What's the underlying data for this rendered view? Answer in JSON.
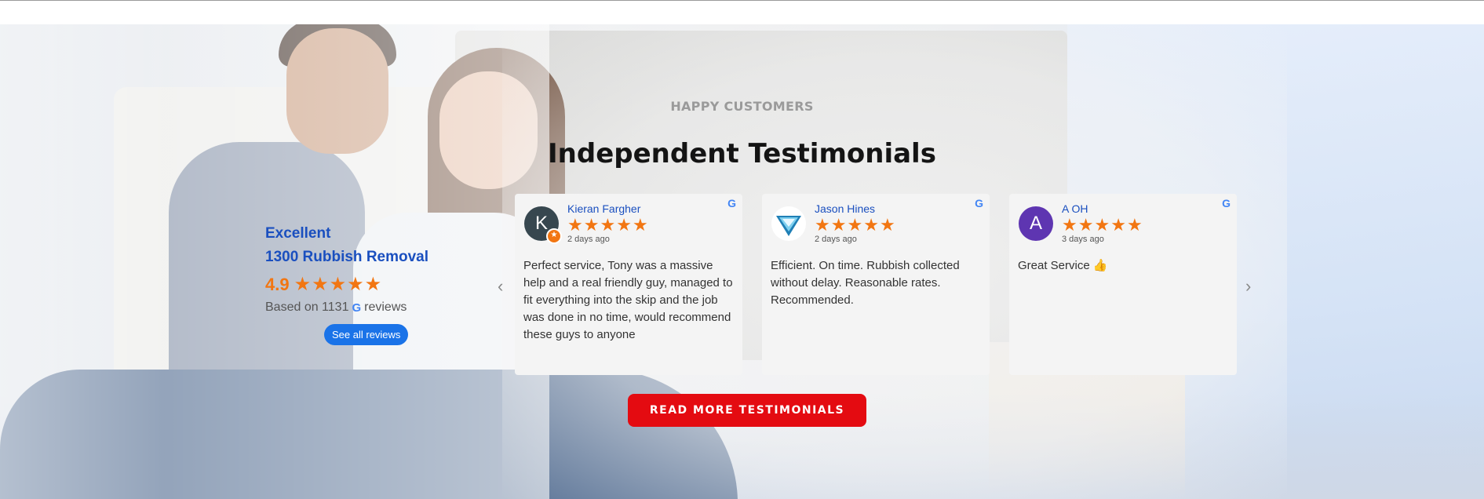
{
  "section": {
    "eyebrow": "HAPPY CUSTOMERS",
    "title": "Independent Testimonials"
  },
  "summary": {
    "label": "Excellent",
    "company": "1300 Rubbish Removal",
    "rating": "4.9",
    "stars": 5,
    "based_prefix": "Based on 1131",
    "based_suffix": "reviews",
    "google_glyph": "G",
    "see_all": "See all reviews"
  },
  "carousel": {
    "prev_icon": "‹",
    "next_icon": "›",
    "reviews": [
      {
        "name": "Kieran Fargher",
        "avatar_letter": "K",
        "avatar_color": "#37474f",
        "stars": 5,
        "date": "2 days ago",
        "text": "Perfect service, Tony was a massive help and a real friendly guy, managed to fit everything into the skip and the job was done in no time, would recommend these guys to anyone"
      },
      {
        "name": "Jason Hines",
        "avatar_letter": "",
        "avatar_color": "#0f4c81",
        "stars": 5,
        "date": "2 days ago",
        "text": "Efficient. On time. Rubbish collected without delay. Reasonable rates. Recommended."
      },
      {
        "name": "A OH",
        "avatar_letter": "A",
        "avatar_color": "#5e35b1",
        "stars": 5,
        "date": "3 days ago",
        "text": "Great Service 👍"
      }
    ]
  },
  "cta": {
    "label": "READ MORE TESTIMONIALS"
  },
  "colors": {
    "brand_blue": "#1a4fbf",
    "star_orange": "#f27612",
    "cta_red": "#e40b11",
    "google_blue": "#4285F4"
  }
}
